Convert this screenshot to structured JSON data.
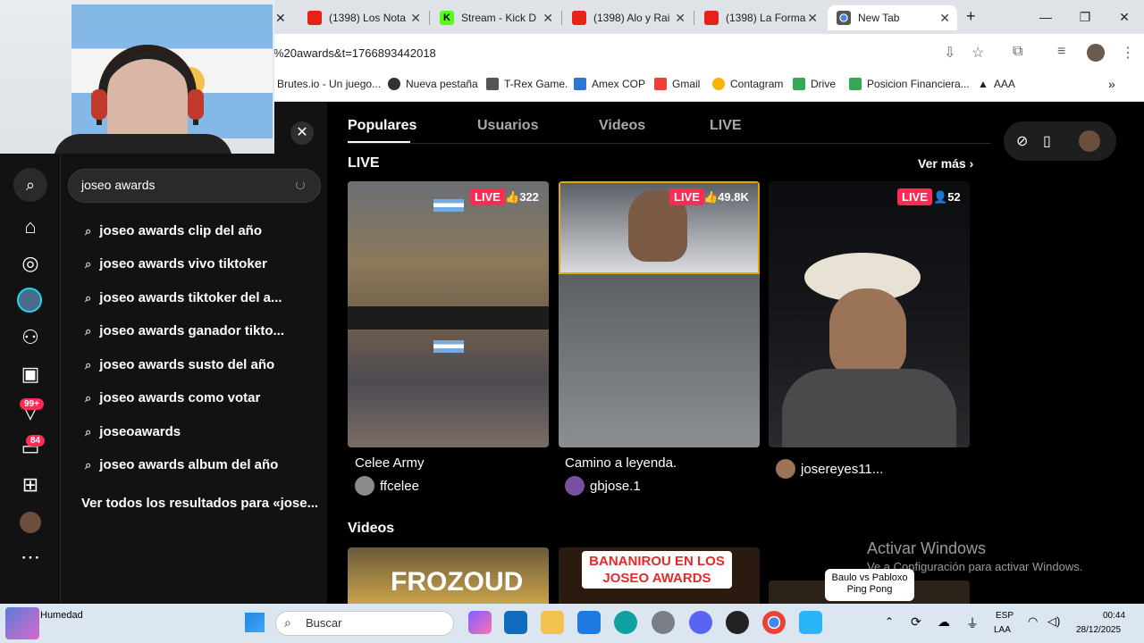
{
  "browser": {
    "tabs": [
      {
        "title": "(1398) Los Nota",
        "icon": "youtube-icon"
      },
      {
        "title": "Stream - Kick D",
        "icon": "kick-icon"
      },
      {
        "title": "(1398) Alo y Rai",
        "icon": "youtube-icon"
      },
      {
        "title": "(1398) La Forma",
        "icon": "youtube-icon"
      },
      {
        "title": "New Tab",
        "icon": "chrome-icon"
      }
    ],
    "url": "%20awards&t=1766893442018",
    "bookmarks": [
      "Brutes.io - Un juego...",
      "Nueva pestaña",
      "T-Rex Game.",
      "Amex COP",
      "Gmail",
      "Contagram",
      "Drive",
      "Posicion Financiera...",
      "AAA"
    ]
  },
  "search": {
    "query": "joseo awards",
    "suggestions": [
      "joseo awards clip del año",
      "joseo awards vivo tiktoker",
      "joseo awards tiktoker del a...",
      "joseo awards ganador tikto...",
      "joseo awards susto del año",
      "joseo awards como votar",
      "joseoawards",
      "joseo awards album del año"
    ],
    "see_all": "Ver todos los resultados para «jose..."
  },
  "rail": {
    "badge_friends": "99+",
    "badge_inbox": "84"
  },
  "results": {
    "tabs": [
      "Populares",
      "Usuarios",
      "Videos",
      "LIVE"
    ],
    "live_section": "LIVE",
    "see_more": "Ver más",
    "live_label": "LIVE",
    "cards": [
      {
        "title": "Celee Army",
        "user": "ffcelee",
        "viewers": "322"
      },
      {
        "title": "Camino a leyenda.",
        "user": "gbjose.1",
        "viewers": "49.8K"
      },
      {
        "title": "",
        "user": "josereyes11...",
        "viewers": "52"
      }
    ],
    "videos_section": "Videos",
    "video_thumbs": [
      "FROZOUD",
      "BANANIROU EN LOS JOSEO AWARDS"
    ]
  },
  "overlay": {
    "activate_title": "Activar Windows",
    "activate_sub": "Ve a Configuración para activar Windows.",
    "tooltip_line1": "Baulo vs Pabloxo",
    "tooltip_line2": "Ping Pong"
  },
  "taskbar": {
    "weather": "Humedad",
    "search": "Buscar",
    "lang1": "ESP",
    "lang2": "LAA",
    "time": "00:44",
    "date": "28/12/2025"
  }
}
